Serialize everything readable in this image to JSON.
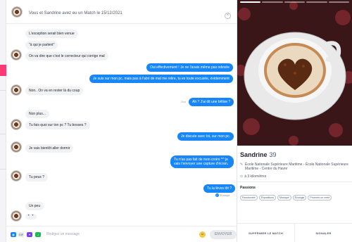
{
  "header": {
    "match_text": "Vous et Sandrine avez eu un Match le 15/12/2021",
    "close_symbol": "×"
  },
  "messages": [
    {
      "dir": "in",
      "text": "L'exception serait bien venue"
    },
    {
      "dir": "in",
      "text": "\"à qui je parlent\""
    },
    {
      "dir": "in",
      "text": "On va dire que c'est le correcteur qui corrige mal"
    },
    {
      "dir": "out",
      "text": "Oui effectivement ! Je ne l'avais même pas relevée"
    },
    {
      "dir": "out",
      "text": "Je suis sur mon pc, mais pas à l'abri de mal me relire, tu es toute excusée, évidemment"
    },
    {
      "dir": "in",
      "text": "Non.. On va en rester là du coup"
    },
    {
      "dir": "out",
      "text": "Ah ? J'ai dit une bêtise ?"
    },
    {
      "dir": "in",
      "text": "Non plus..."
    },
    {
      "dir": "in",
      "text": "Tu fais quoi sur ton pc ? Tu bosses ?"
    },
    {
      "dir": "out",
      "text": "Je discute avec toi, sur mon pc."
    },
    {
      "dir": "in",
      "text": "Je vais bientôt aller dormir"
    },
    {
      "dir": "out",
      "text": "Tu n'as pas fait de mon croire ^^ je vais t'envoyer une capture d'écran."
    },
    {
      "dir": "in",
      "text": "Tu peux ?"
    },
    {
      "dir": "out",
      "text": "Tu la lèves tôt ?"
    },
    {
      "dir": "in",
      "text": "Un peu"
    }
  ],
  "timestamp": "2nd",
  "sent_status": "Envoyé",
  "typing_indicator": "• •",
  "composer": {
    "icon_gif": "GIF",
    "input_placeholder": "Rédigez un message",
    "send_label": "ENVOYER"
  },
  "profile": {
    "name": "Sandrine",
    "age": "39",
    "school": "École Nationale Supérieure Maritime - École Nationale Supérieure Maritime - Centre du Havre",
    "distance": "à 3 kilomètres",
    "passions_title": "Passions",
    "passions": [
      "Randonnée",
      "Expositions",
      "Musique",
      "Écologie",
      "Promnér un verre"
    ]
  },
  "actions": {
    "unmatch": "SUPPRIMER LE MATCH",
    "report": "SIGNALER"
  },
  "colors": {
    "accent_blue": "#1786f8",
    "brand_pink": "#fd3a73",
    "bubble_gray": "#f0f2f4"
  }
}
